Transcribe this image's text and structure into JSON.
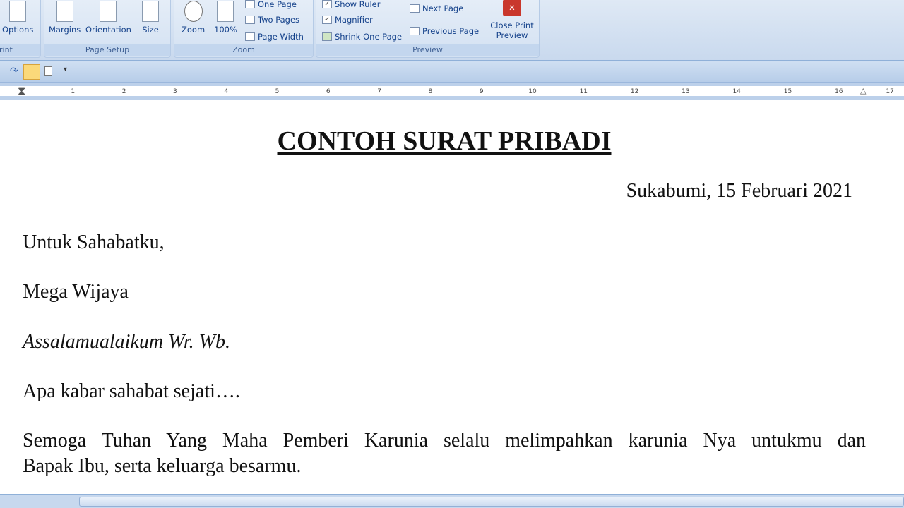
{
  "ribbon": {
    "print_group": {
      "options": "Options",
      "label": "rint"
    },
    "page_setup": {
      "margins": "Margins",
      "orientation": "Orientation",
      "size": "Size",
      "label": "Page Setup"
    },
    "zoom": {
      "zoom": "Zoom",
      "hundred": "100%",
      "one_page": "One Page",
      "two_pages": "Two Pages",
      "page_width": "Page Width",
      "label": "Zoom"
    },
    "preview": {
      "show_ruler": "Show Ruler",
      "show_ruler_checked": true,
      "magnifier": "Magnifier",
      "magnifier_checked": true,
      "shrink": "Shrink One Page",
      "next_page": "Next Page",
      "previous_page": "Previous Page",
      "close": "Close Print Preview",
      "label": "Preview"
    }
  },
  "ruler": {
    "numbers": [
      "1",
      "2",
      "3",
      "4",
      "5",
      "6",
      "7",
      "8",
      "9",
      "10",
      "11",
      "12",
      "13",
      "14",
      "15",
      "16",
      "17"
    ]
  },
  "document": {
    "title": "CONTOH SURAT PRIBADI",
    "date": "Sukabumi, 15 Februari 2021",
    "greeting": "Untuk Sahabatku,",
    "name": "Mega Wijaya",
    "salam": "Assalamualaikum Wr. Wb.",
    "line1": "Apa kabar sahabat sejati….",
    "para_line1": "Semoga Tuhan Yang Maha Pemberi Karunia selalu melimpahkan karunia Nya untukmu dan",
    "para_line2": "Bapak Ibu, serta keluarga besarmu."
  }
}
